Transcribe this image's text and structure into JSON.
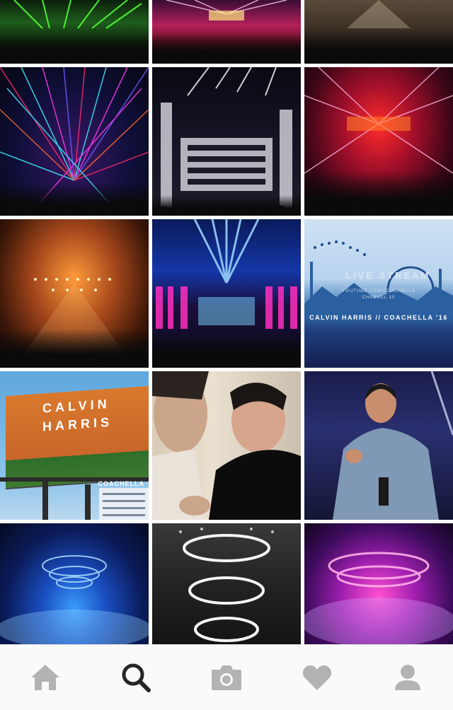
{
  "grid": {
    "tiles": [
      {
        "row": 0,
        "col": 0,
        "kind": "concert-green"
      },
      {
        "row": 0,
        "col": 1,
        "kind": "concert-red"
      },
      {
        "row": 0,
        "col": 2,
        "kind": "concert-dim"
      },
      {
        "row": 1,
        "col": 0,
        "kind": "laser-rainbow"
      },
      {
        "row": 1,
        "col": 1,
        "kind": "stage-towers"
      },
      {
        "row": 1,
        "col": 2,
        "kind": "concert-red-lasers"
      },
      {
        "row": 2,
        "col": 0,
        "kind": "concert-orange"
      },
      {
        "row": 2,
        "col": 1,
        "kind": "stage-blue-pink"
      },
      {
        "row": 2,
        "col": 2,
        "kind": "livestream-poster"
      },
      {
        "row": 3,
        "col": 0,
        "kind": "billboard"
      },
      {
        "row": 3,
        "col": 1,
        "kind": "selfie"
      },
      {
        "row": 3,
        "col": 2,
        "kind": "performer"
      },
      {
        "row": 4,
        "col": 0,
        "kind": "stage-rings-blue"
      },
      {
        "row": 4,
        "col": 1,
        "kind": "stage-rings-white"
      },
      {
        "row": 4,
        "col": 2,
        "kind": "stage-rings-purple"
      }
    ],
    "poster": {
      "title": "LIVE STREAM",
      "lines": [
        "YOUTUBE.COM/COACHELLA",
        "CHANNEL 10"
      ],
      "caption": "CALVIN HARRIS // COACHELLA '16"
    },
    "billboard": {
      "title_line1": "CALVIN",
      "title_line2": "HARRIS",
      "sub": "COACHELLA"
    }
  },
  "tabbar": {
    "active": "search",
    "icons": [
      "home-icon",
      "search-icon",
      "camera-icon",
      "heart-icon",
      "profile-icon"
    ],
    "colors": {
      "active": "#262626",
      "inactive": "#b3b3b3"
    }
  }
}
